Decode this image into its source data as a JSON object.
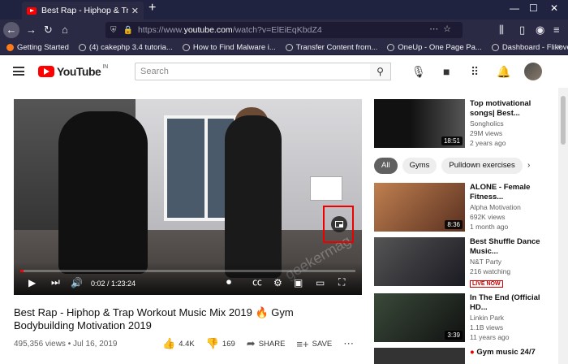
{
  "browser": {
    "tab_title": "Best Rap - Hiphop & Trap Workout",
    "url_host": "https://www.",
    "url_domain": "youtube.com",
    "url_path": "/watch?v=ElEiEqKbdZ4",
    "bookmarks": [
      {
        "label": "Getting Started"
      },
      {
        "label": "(4) cakephp 3.4 tutoria..."
      },
      {
        "label": "How to Find Malware i..."
      },
      {
        "label": "Transfer Content from..."
      },
      {
        "label": "OneUp - One Page Pa..."
      },
      {
        "label": "Dashboard - Flikover"
      }
    ]
  },
  "header": {
    "logo_text": "YouTube",
    "region": "IN",
    "search_placeholder": "Search"
  },
  "player": {
    "time": "0:02 / 1:23:24",
    "progress_fraction": 0.01,
    "watermark": "geekermag"
  },
  "video": {
    "title": "Best Rap - Hiphop & Trap Workout Music Mix 2019 🔥 Gym Bodybuilding Motivation 2019",
    "views": "495,356 views",
    "date": "Jul 16, 2019",
    "likes": "4.4K",
    "dislikes": "169",
    "share_label": "SHARE",
    "save_label": "SAVE"
  },
  "chips": [
    {
      "label": "All",
      "active": true
    },
    {
      "label": "Gyms"
    },
    {
      "label": "Pulldown exercises"
    }
  ],
  "sidebar": [
    {
      "title": "Top motivational songs| Best...",
      "channel": "Songholics",
      "views": "29M views",
      "age": "2 years ago",
      "duration": "18:51",
      "color": "#222"
    },
    {
      "title": "ALONE - Female Fitness...",
      "channel": "Alpha Motivation",
      "views": "692K views",
      "age": "1 month ago",
      "duration": "8:36",
      "color": "#8a5a3a"
    },
    {
      "title": "Best Shuffle Dance Music...",
      "channel": "N&T Party",
      "views": "216 watching",
      "age": "",
      "live": "LIVE NOW",
      "color": "#3a3a4a"
    },
    {
      "title": "In The End (Official HD...",
      "channel": "Linkin Park",
      "views": "1.1B views",
      "age": "11 years ago",
      "duration": "3:39",
      "color": "#2a3a2a"
    },
    {
      "title": "Gym music 24/7",
      "channel": "",
      "views": "",
      "age": "",
      "color": "#333"
    }
  ]
}
